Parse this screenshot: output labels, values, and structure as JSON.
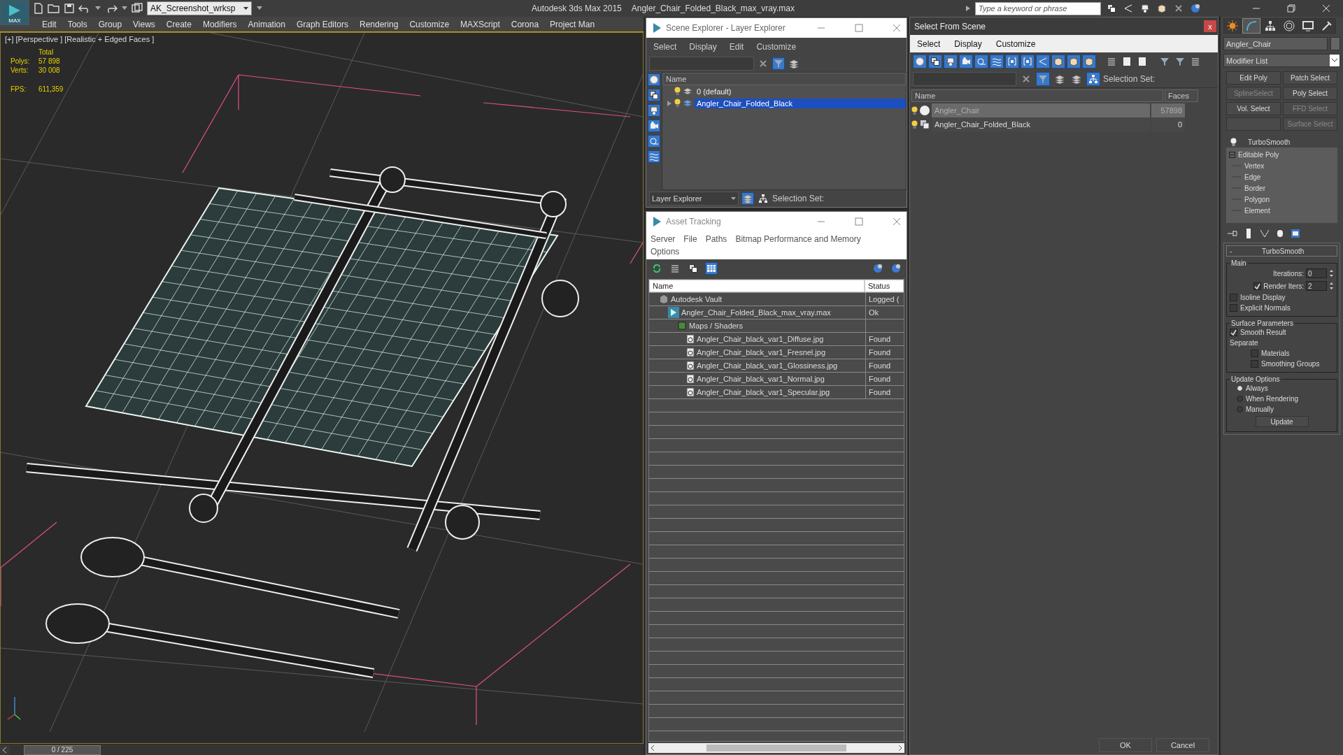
{
  "title_bar": {
    "app_button": "MAX",
    "workspace": "AK_Screenshot_wrksp",
    "title": "Autodesk 3ds Max  2015",
    "file": "Angler_Chair_Folded_Black_max_vray.max",
    "search": {
      "placeholder": "Type a keyword or phrase"
    }
  },
  "menu_bar": [
    "Edit",
    "Tools",
    "Group",
    "Views",
    "Create",
    "Modifiers",
    "Animation",
    "Graph Editors",
    "Rendering",
    "Customize",
    "MAXScript",
    "Corona",
    "Project Man"
  ],
  "viewport": {
    "labels": [
      "[+]",
      "[Perspective ]",
      "[Realistic + Edged Faces ]"
    ],
    "stats": {
      "header": "Total",
      "rows": [
        {
          "label": "Polys:",
          "value": "57 898"
        },
        {
          "label": "Verts:",
          "value": "30 008"
        },
        {
          "label": "FPS:",
          "value": "611,359"
        }
      ]
    }
  },
  "time_slider": {
    "label": "0 / 225"
  },
  "scene_explorer": {
    "title": "Scene Explorer - Layer Explorer",
    "menu": [
      "Select",
      "Display",
      "Edit",
      "Customize"
    ],
    "column": "Name",
    "layers": [
      {
        "name": "0 (default)",
        "has_children": false,
        "selected": false
      },
      {
        "name": "Angler_Chair_Folded_Black",
        "has_children": true,
        "selected": true
      }
    ],
    "explorer_mode": "Layer Explorer",
    "selection_set_label": "Selection Set:"
  },
  "asset_tracking": {
    "title": "Asset Tracking",
    "menu": [
      "Server",
      "File",
      "Paths",
      "Bitmap Performance and Memory",
      "Options"
    ],
    "columns": [
      "Name",
      "Status"
    ],
    "assets": [
      {
        "kind": "vault",
        "name": "Autodesk Vault",
        "status": "Logged (",
        "children": [
          {
            "kind": "scene",
            "name": "Angler_Chair_Folded_Black_max_vray.max",
            "status": "Ok",
            "children": [
              {
                "kind": "folder",
                "name": "Maps / Shaders",
                "children": [
                  {
                    "kind": "bitmap",
                    "name": "Angler_Chair_black_var1_Diffuse.jpg",
                    "status": "Found"
                  },
                  {
                    "kind": "bitmap",
                    "name": "Angler_Chair_black_var1_Fresnel.jpg",
                    "status": "Found"
                  },
                  {
                    "kind": "bitmap",
                    "name": "Angler_Chair_black_var1_Glossiness.jpg",
                    "status": "Found"
                  },
                  {
                    "kind": "bitmap",
                    "name": "Angler_Chair_black_var1_Normal.jpg",
                    "status": "Found"
                  },
                  {
                    "kind": "bitmap",
                    "name": "Angler_Chair_black_var1_Specular.jpg",
                    "status": "Found"
                  }
                ]
              }
            ]
          }
        ]
      }
    ]
  },
  "select_from_scene": {
    "title": "Select From Scene",
    "close": "x",
    "menu": [
      "Select",
      "Display",
      "Customize"
    ],
    "selection_set_label": "Selection Set:",
    "columns": [
      "Name",
      "Faces"
    ],
    "objects": [
      {
        "kind": "geometry",
        "name": "Angler_Chair",
        "faces": "57898",
        "selected": true
      },
      {
        "kind": "group",
        "name": "Angler_Chair_Folded_Black",
        "faces": "0",
        "selected": false
      }
    ],
    "buttons": [
      "OK",
      "Cancel"
    ]
  },
  "command_panel": {
    "tabs": [
      {
        "kind": "create",
        "selected": false
      },
      {
        "kind": "modify",
        "selected": true
      },
      {
        "kind": "hierarchy",
        "selected": false
      },
      {
        "kind": "motion",
        "selected": false
      },
      {
        "kind": "display",
        "selected": false
      },
      {
        "kind": "utilities",
        "selected": false
      }
    ],
    "object_name": "Angler_Chair",
    "modifier_list": "Modifier List",
    "modifier_buttons": [
      {
        "kind": "button",
        "label": "Edit Poly",
        "disabled": false
      },
      {
        "kind": "button",
        "label": "Patch Select",
        "disabled": false
      },
      {
        "kind": "button",
        "label": "SplineSelect",
        "disabled": true
      },
      {
        "kind": "button",
        "label": "Poly Select",
        "disabled": false
      },
      {
        "kind": "button",
        "label": "Vol. Select",
        "disabled": false
      },
      {
        "kind": "button",
        "label": "FFD Select",
        "disabled": true
      },
      {
        "kind": "blank"
      },
      {
        "kind": "button",
        "label": "Surface Select",
        "disabled": true
      }
    ],
    "stack": [
      {
        "kind": "modifier",
        "name": "TurboSmooth"
      },
      {
        "kind": "object",
        "name": "Editable Poly",
        "expanded": true,
        "children": [
          {
            "name": "Vertex"
          },
          {
            "name": "Edge"
          },
          {
            "name": "Border"
          },
          {
            "name": "Polygon"
          },
          {
            "name": "Element"
          }
        ]
      }
    ],
    "rollout": {
      "title": "TurboSmooth",
      "toggle": "-",
      "main": {
        "label": "Main",
        "iterations": {
          "label": "Iterations:",
          "value": "0"
        },
        "render_iters": {
          "label": "Render Iters:",
          "value": "2",
          "checked": true
        },
        "options": [
          {
            "label": "Isoline Display",
            "checked": false
          },
          {
            "label": "Explicit Normals",
            "checked": false
          }
        ]
      },
      "surface": {
        "label": "Surface Parameters",
        "smooth_result": {
          "label": "Smooth Result",
          "checked": true
        },
        "separate_label": "Separate",
        "separate": [
          {
            "label": "Materials",
            "checked": false
          },
          {
            "label": "Smoothing Groups",
            "checked": false
          }
        ]
      },
      "update": {
        "label": "Update Options",
        "options": [
          {
            "label": "Always",
            "selected": true
          },
          {
            "label": "When Rendering",
            "selected": false
          },
          {
            "label": "Manually",
            "selected": false
          }
        ],
        "button": "Update"
      }
    }
  }
}
